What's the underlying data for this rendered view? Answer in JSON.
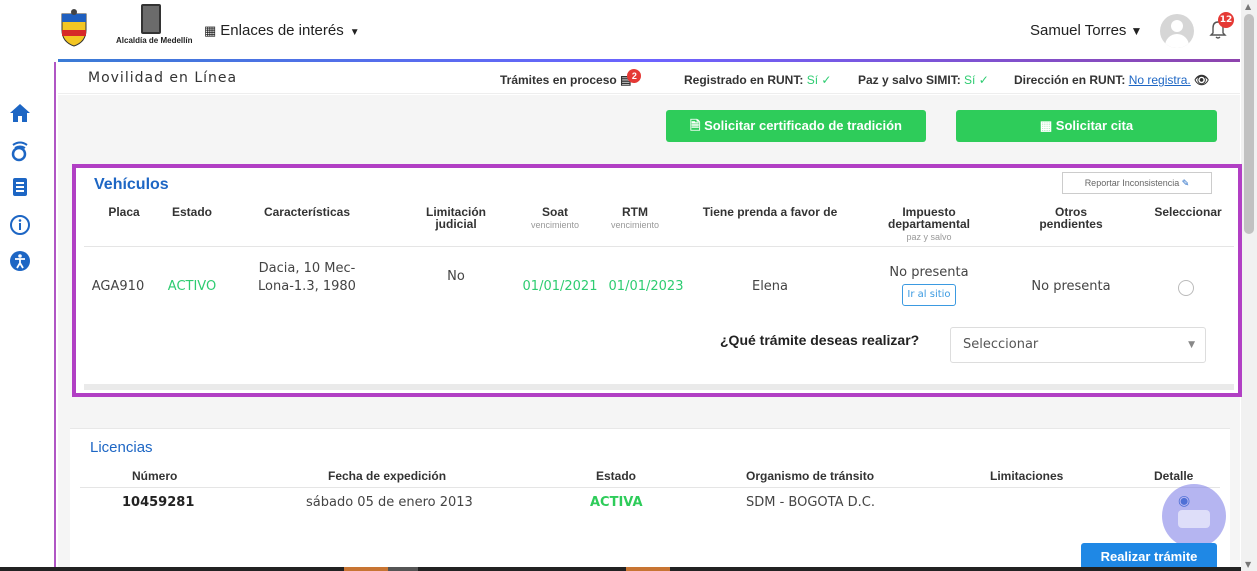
{
  "header": {
    "logo_caption": "Alcaldía de Medellín",
    "links_label": "Enlaces de interés",
    "user_name": "Samuel Torres",
    "notifications_count": "12"
  },
  "subheader": {
    "title": "Movilidad en Línea",
    "tramites_label": "Trámites en proceso",
    "tramites_count": "2",
    "runt_label": "Registrado en RUNT:",
    "runt_value": "Sí ✓",
    "simit_label": "Paz y salvo SIMIT:",
    "simit_value": "Sí ✓",
    "direccion_label": "Dirección en RUNT:",
    "direccion_link": "No registra."
  },
  "actions": {
    "certificado": "Solicitar certificado de tradición",
    "cita": "Solicitar cita"
  },
  "vehiculos": {
    "title": "Vehículos",
    "report_label": "Reportar Inconsistencia",
    "headers": {
      "placa": "Placa",
      "estado": "Estado",
      "caracteristicas": "Características",
      "limitacion": "Limitación judicial",
      "soat": "Soat",
      "soat_sub": "vencimiento",
      "rtm": "RTM",
      "rtm_sub": "vencimiento",
      "prenda": "Tiene prenda a favor de",
      "impuesto": "Impuesto departamental",
      "impuesto_sub": "paz y salvo",
      "otros": "Otros pendientes",
      "seleccionar": "Seleccionar"
    },
    "row": {
      "placa": "AGA910",
      "estado": "ACTIVO",
      "caracteristicas": "Dacia, 10 Mec-Lona-1.3, 1980",
      "limitacion": "No",
      "soat": "01/01/2021",
      "rtm": "01/01/2023",
      "prenda": "Elena",
      "impuesto": "No presenta",
      "impuesto_link": "Ir al sitio",
      "otros": "No presenta"
    },
    "question": "¿Qué trámite deseas realizar?",
    "select_value": "Seleccionar"
  },
  "licencias": {
    "title": "Licencias",
    "headers": {
      "numero": "Número",
      "fecha": "Fecha de expedición",
      "estado": "Estado",
      "organismo": "Organismo de tránsito",
      "limitaciones": "Limitaciones",
      "detalle": "Detalle"
    },
    "row": {
      "numero": "10459281",
      "fecha": "sábado 05 de enero 2013",
      "estado": "ACTIVA",
      "organismo": "SDM - BOGOTA D.C.",
      "limitaciones": ""
    },
    "action": "Realizar trámite"
  },
  "colors": {
    "accent_blue": "#1d66c4",
    "green": "#2ecc5a",
    "highlight": "#b13fc4"
  }
}
